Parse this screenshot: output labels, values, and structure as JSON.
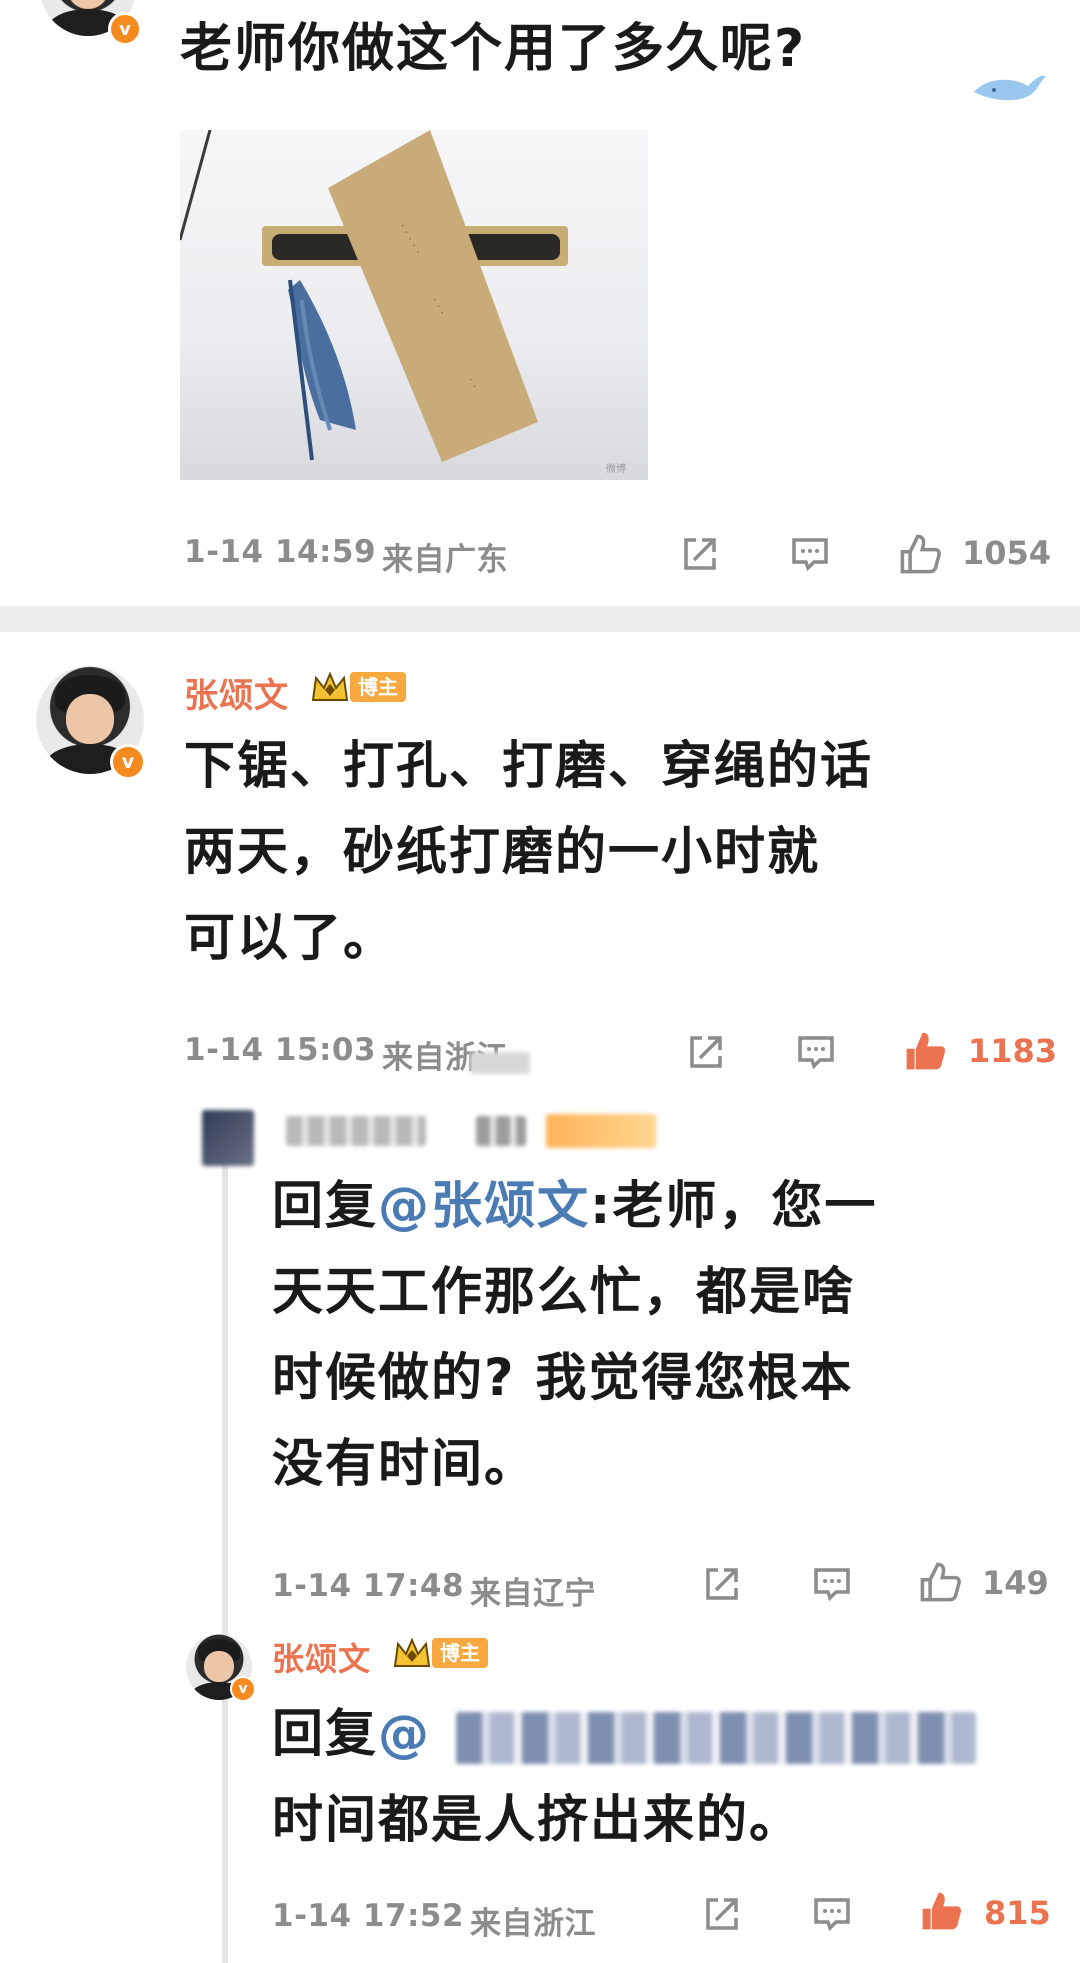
{
  "top_comment": {
    "text": "老师你做这个用了多久呢?",
    "date": "1-14 14:59",
    "location": "来自广东",
    "likes": "1054"
  },
  "reply1": {
    "author": "张颂文",
    "tag": "博主",
    "text_lines": [
      "下锯、打孔、打磨、穿绳的话",
      "两天，砂纸打磨的一小时就",
      "可以了。"
    ],
    "date": "1-14 15:03",
    "location": "来自浙江",
    "likes": "1183"
  },
  "reply2": {
    "prefix": "回复",
    "mention": "@张颂文",
    "line1_rest": ":老师，您一",
    "text_lines": [
      "天天工作那么忙，都是啥",
      "时候做的? 我觉得您根本",
      "没有时间。"
    ],
    "date": "1-14 17:48",
    "location": "来自辽宁",
    "likes": "149"
  },
  "reply3": {
    "author": "张颂文",
    "tag": "博主",
    "prefix": "回复",
    "mention_start": "@",
    "text_line2": "时间都是人挤出来的。",
    "date": "1-14 17:52",
    "location": "来自浙江",
    "likes": "815"
  },
  "icons": {
    "share": "share-icon",
    "comment": "comment-icon",
    "like": "thumbs-up-icon",
    "verified": "verified-v-icon",
    "crown": "crown-icon",
    "watermark": "whale-icon"
  },
  "colors": {
    "name": "#eb7350",
    "mention": "#4a7bb5",
    "meta": "#8c8c8c",
    "like_active": "#eb7350",
    "badge": "#f58a1f"
  }
}
